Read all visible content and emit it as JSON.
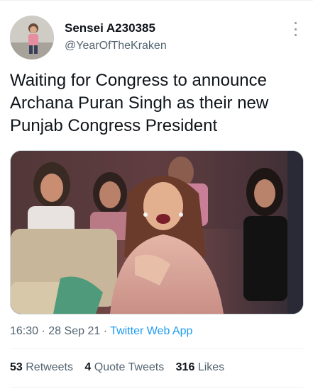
{
  "author": {
    "display_name": "Sensei A230385",
    "handle": "@YearOfTheKraken",
    "avatar_icon": "profile-photo-child"
  },
  "more_icon": "more-vertical-icon",
  "tweet": {
    "lines": [
      "Waiting for Congress to announce",
      "Archana Puran Singh as their new",
      "Punjab Congress President"
    ]
  },
  "media": {
    "kind": "photo",
    "description_icon": "tweet-photo"
  },
  "meta": {
    "time": "16:30",
    "sep1": "·",
    "date": "28 Sep 21",
    "sep2": "·",
    "app": "Twitter Web App"
  },
  "stats": {
    "retweets_count": "53",
    "retweets_label": "Retweets",
    "quotes_count": "4",
    "quotes_label": "Quote Tweets",
    "likes_count": "316",
    "likes_label": "Likes"
  },
  "colors": {
    "text": "#0f1419",
    "secondary": "#536471",
    "link": "#1d9bf0",
    "divider": "#eff3f4"
  }
}
